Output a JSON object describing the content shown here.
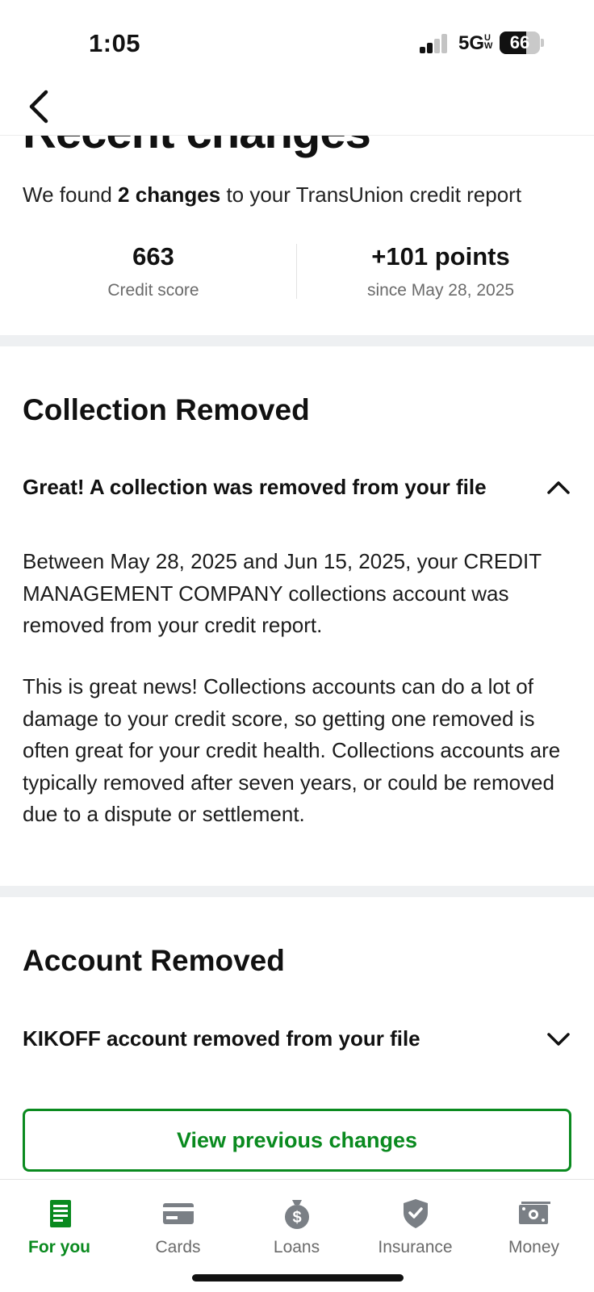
{
  "status_bar": {
    "time": "1:05",
    "network": "5G",
    "network_suffix": "UW",
    "battery": "66",
    "battery_level_percent": 66
  },
  "header": {
    "title": "Recent changes"
  },
  "summary": {
    "prefix": "We found ",
    "highlight": "2 changes",
    "suffix": " to your TransUnion credit report"
  },
  "stats": {
    "score_value": "663",
    "score_label": "Credit score",
    "change_value": "+101 points",
    "change_label": "since May 28, 2025"
  },
  "sections": [
    {
      "title": "Collection Removed",
      "row_label": "Great! A collection was removed from your file",
      "expanded": true,
      "paragraphs": [
        "Between May 28, 2025 and Jun 15, 2025, your CREDIT MANAGEMENT COMPANY collections account was removed from your credit report.",
        "This is great news! Collections accounts can do a lot of damage to your credit score, so getting one removed is often great for your credit health. Collections accounts are typically removed after seven years, or could be removed due to a dispute or settlement."
      ]
    },
    {
      "title": "Account Removed",
      "row_label": "KIKOFF account removed from your file",
      "expanded": false
    }
  ],
  "view_previous_label": "View previous changes",
  "tabs": [
    {
      "label": "For you",
      "icon": "document-icon",
      "active": true
    },
    {
      "label": "Cards",
      "icon": "card-icon",
      "active": false
    },
    {
      "label": "Loans",
      "icon": "money-bag-icon",
      "active": false
    },
    {
      "label": "Insurance",
      "icon": "shield-check-icon",
      "active": false
    },
    {
      "label": "Money",
      "icon": "cash-icon",
      "active": false
    }
  ],
  "colors": {
    "accent_green": "#0a8a1f",
    "divider_gray": "#eef0f2",
    "muted_text": "#6b6b6b",
    "icon_gray": "#7a7f85"
  }
}
